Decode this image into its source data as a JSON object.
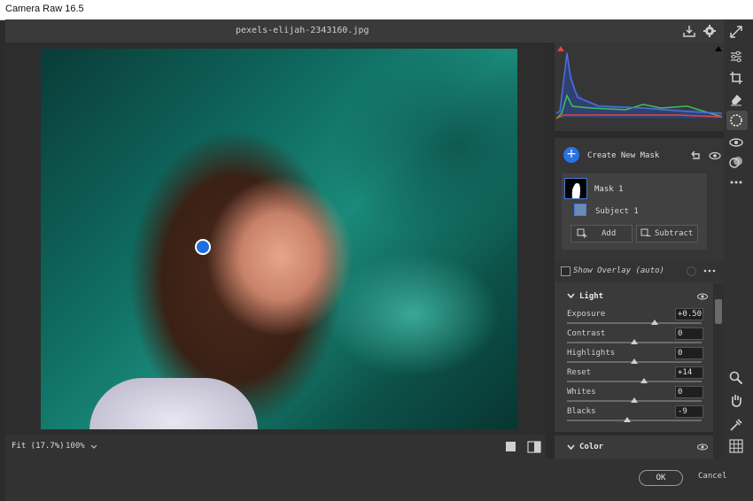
{
  "window": {
    "title": "Camera Raw 16.5"
  },
  "topbar": {
    "filename": "pexels-elijah-2343160.jpg"
  },
  "masking": {
    "create_label": "Create New Mask",
    "mask_name": "Mask 1",
    "component_name": "Subject 1",
    "add_label": "Add",
    "subtract_label": "Subtract",
    "overlay_label": "Show Overlay (auto)"
  },
  "light": {
    "title": "Light",
    "sliders": [
      {
        "label": "Exposure",
        "value": "+0.50",
        "position": 0.65
      },
      {
        "label": "Contrast",
        "value": "0",
        "position": 0.5
      },
      {
        "label": "Highlights",
        "value": "0",
        "position": 0.5
      },
      {
        "label": "Reset",
        "value": "+14",
        "position": 0.57
      },
      {
        "label": "Whites",
        "value": "0",
        "position": 0.5
      },
      {
        "label": "Blacks",
        "value": "-9",
        "position": 0.45
      }
    ]
  },
  "color": {
    "title": "Color"
  },
  "zoom": {
    "fit_label": "Fit (17.7%)",
    "level": "100%"
  },
  "footer": {
    "ok_label": "OK",
    "cancel_label": "Cancel"
  },
  "colors": {
    "accent": "#2a72e5",
    "panel": "#363636",
    "background": "#2b2b2b"
  }
}
